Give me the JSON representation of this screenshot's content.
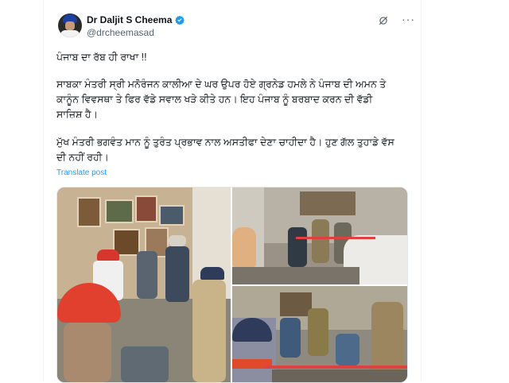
{
  "author": {
    "display_name": "Dr Daljit S Cheema",
    "handle": "@drcheemasad",
    "verified": true,
    "avatar_icon": "profile-photo"
  },
  "actions": {
    "grok_icon": "grok-icon",
    "more_label": "···"
  },
  "post": {
    "line1": "ਪੰਜਾਬ ਦਾ ਰੱਬ ਹੀ ਰਾਖਾ !!",
    "para2_line1": "ਸਾਬਕਾ ਮੰਤਰੀ ਸ੍ਰੀ ਮਨੋਰੰਜਨ ਕਾਲੀਆ ਦੇ ਘਰ ਉਪਰ ਹੋਏ ਗ੍ਰਨੇਡ ਹਮਲੇ ਨੇ ਪੰਜਾਬ ਦੀ ਅਮਨ ਤੇ",
    "para2_line2": "ਕਾਨੂੰਨ ਵਿਵਸਥਾ ਤੇ ਫਿਰ ਵੱਡੇ ਸਵਾਲ ਖੜੇ ਕੀਤੇ ਹਨ। ਇਹ ਪੰਜਾਬ ਨੂੰ ਬਰਬਾਦ ਕਰਨ ਦੀ ਵੱਡੀ",
    "para2_line3": "ਸਾਜ਼ਿਸ਼ ਹੈ।",
    "para3_line1": "ਮੁੱਖ ਮੰਤਰੀ ਭਗਵੰਤ ਮਾਨ ਨੂੰ ਤੁਰੰਤ ਪ੍ਰਭਾਵ ਨਾਲ ਅਸਤੀਫਾ ਦੇਣਾ ਚਾਹੀਦਾ ਹੈ। ਹੁਣ ਗੱਲ ਤੁਹਾਡੇ ਵੱਸ",
    "para3_line2": "ਦੀ ਨਹੀਂ ਰਹੀ।",
    "translate_label": "Translate post"
  },
  "colors": {
    "link": "#1d9bf0",
    "muted": "#536471",
    "text": "#0f1419"
  }
}
